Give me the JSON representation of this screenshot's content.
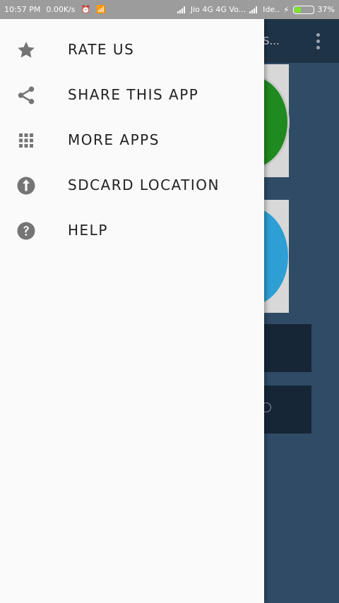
{
  "status_bar": {
    "time": "10:57 PM",
    "speed": "0.00K/s",
    "carrier": "Jio 4G 4G Vo...",
    "carrier2": "Ide..",
    "battery_percent": "37%",
    "battery_level": 0.37
  },
  "app": {
    "title": "S...",
    "overflow_icon": "more-vert-icon"
  },
  "drawer": {
    "items": [
      {
        "label": "RATE US",
        "icon": "star-icon"
      },
      {
        "label": "SHARE THIS APP",
        "icon": "share-icon"
      },
      {
        "label": "MORE APPS",
        "icon": "grid-icon"
      },
      {
        "label": "SDCARD LOCATION",
        "icon": "arrow-up-circle-icon"
      },
      {
        "label": "HELP",
        "icon": "help-circle-icon"
      }
    ]
  },
  "colors": {
    "drawer_bg": "#fafafa",
    "icon_gray": "#757575",
    "app_bg": "#2f4b66",
    "status_bar": "#9c9c9c"
  }
}
